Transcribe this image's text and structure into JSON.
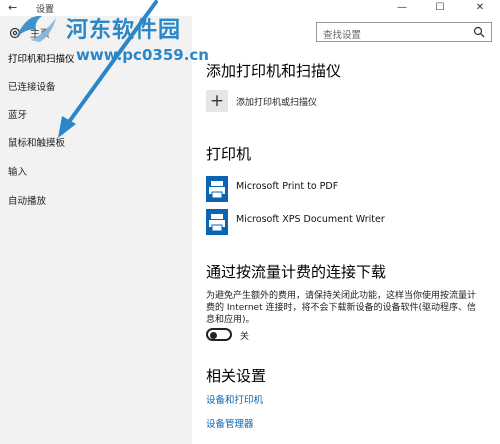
{
  "window": {
    "back_glyph": "←",
    "title": "设置",
    "min_glyph": "—",
    "max_glyph": "☐",
    "close_glyph": "✕"
  },
  "sidebar": {
    "home_label": "主页",
    "items": [
      {
        "label": "打印机和扫描仪",
        "active": true
      },
      {
        "label": "已连接设备"
      },
      {
        "label": "蓝牙"
      },
      {
        "label": "鼠标和触摸板"
      },
      {
        "label": "输入"
      },
      {
        "label": "自动播放"
      }
    ]
  },
  "watermark": {
    "title": "河东软件园",
    "url": "www.pc0359.cn"
  },
  "search": {
    "placeholder": "查找设置"
  },
  "main": {
    "section_printers_scanners": "添加打印机和扫描仪",
    "add_label": "添加打印机或扫描仪",
    "section_printers": "打印机",
    "printers": [
      "Microsoft Print to PDF",
      "Microsoft XPS Document Writer"
    ],
    "section_metered": "通过按流量计费的连接下载",
    "metered_description": "为避免产生额外的费用，请保持关闭此功能，这样当你使用按流量计费的 Internet 连接时，将不会下载新设备的设备软件(驱动程序、信息和应用)。",
    "toggle_label": "关",
    "toggle_on": false,
    "section_related": "相关设置",
    "links": [
      "设备和打印机",
      "设备管理器"
    ]
  },
  "colors": {
    "accent": "#0a64b4",
    "watermark": "#2b86c8",
    "sidebar_bg": "#f2f2f2"
  }
}
